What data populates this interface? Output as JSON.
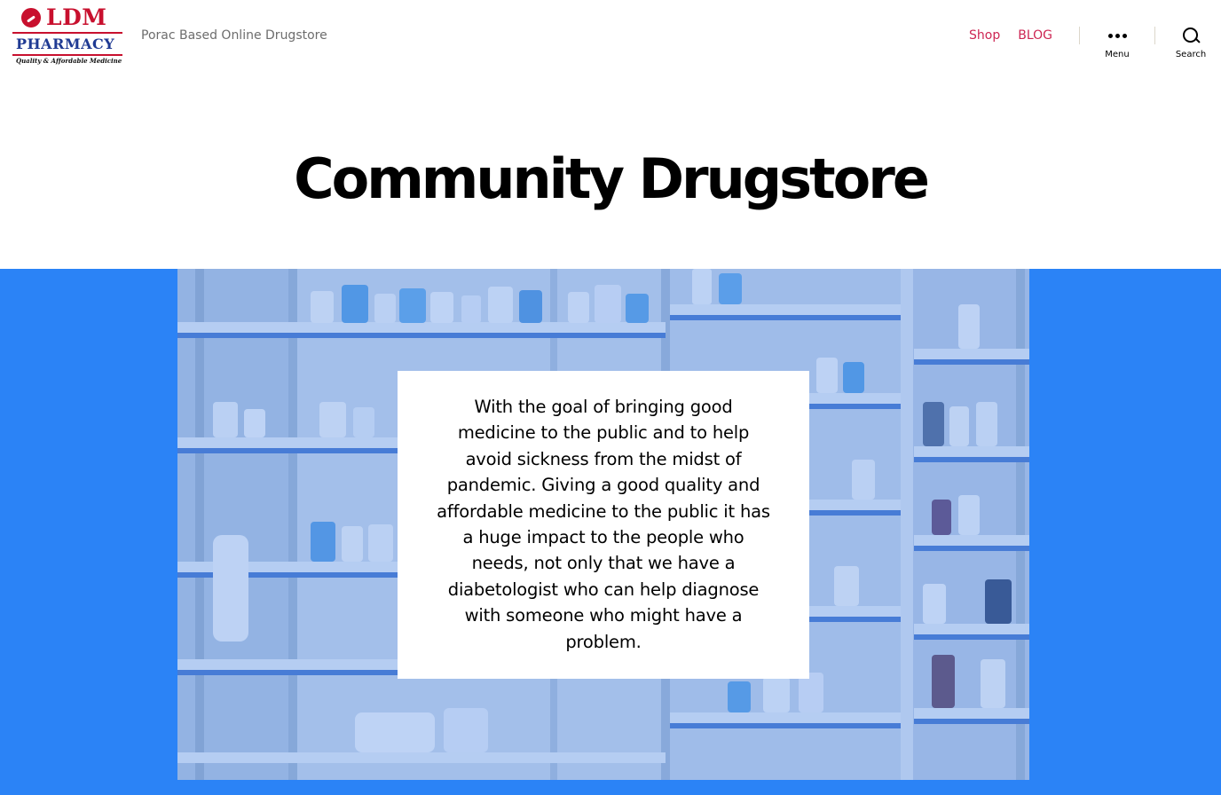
{
  "header": {
    "logo": {
      "line1": "LDM",
      "line2": "PHARMACY",
      "tagline": "Quality & Affordable Medicine"
    },
    "site_description": "Porac Based Online Drugstore",
    "nav": [
      {
        "label": "Shop"
      },
      {
        "label": "BLOG"
      }
    ],
    "menu_toggle_label": "Menu",
    "search_toggle_label": "Search"
  },
  "page": {
    "title": "Community Drugstore",
    "cover_text": "With the goal of bringing good medicine to the public and to help avoid sickness from the midst of pandemic. Giving a good quality and affordable medicine to the public it has a huge impact to the people who needs, not only that we have a diabetologist who can help diagnose with someone who might have a problem."
  },
  "colors": {
    "accent": "#cd2653",
    "cover_band": "#2b83f6",
    "logo_red": "#c8102e",
    "logo_blue": "#1f3a93"
  }
}
